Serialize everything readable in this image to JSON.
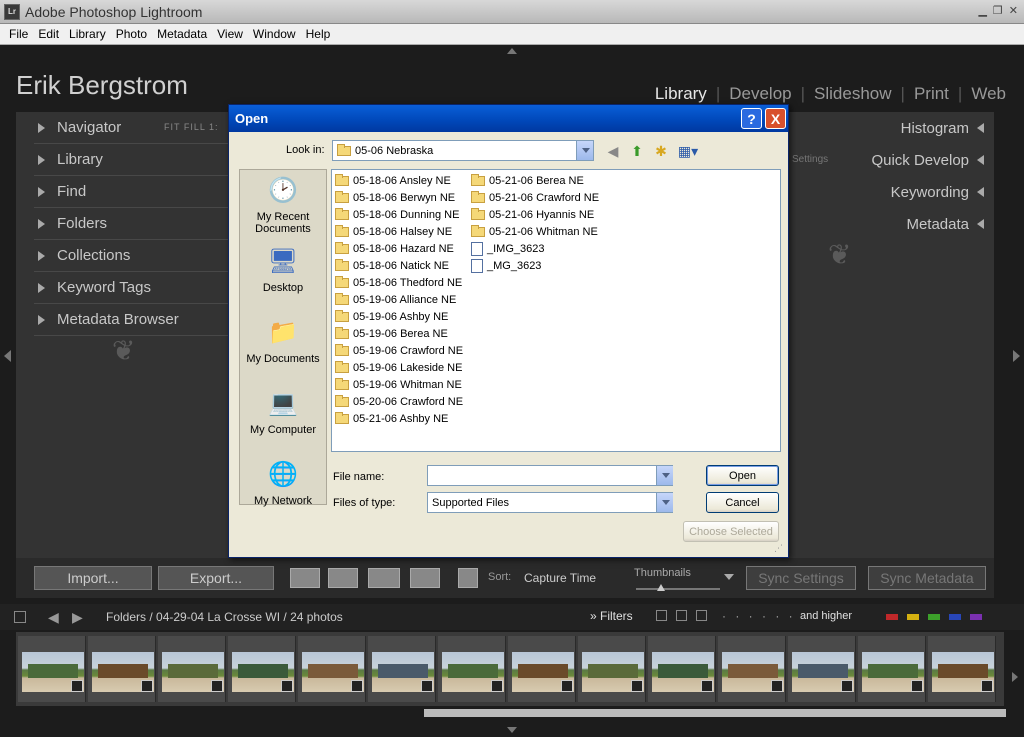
{
  "window": {
    "app_icon": "Lr",
    "title": "Adobe Photoshop Lightroom"
  },
  "menu": [
    "File",
    "Edit",
    "Library",
    "Photo",
    "Metadata",
    "View",
    "Window",
    "Help"
  ],
  "identity_plate": "Erik Bergstrom",
  "modules": [
    "Library",
    "Develop",
    "Slideshow",
    "Print",
    "Web"
  ],
  "active_module": "Library",
  "left_panels": [
    "Navigator",
    "Library",
    "Find",
    "Folders",
    "Collections",
    "Keyword Tags",
    "Metadata Browser"
  ],
  "navigator_modes": "FIT  FILL  1:",
  "right_panels": [
    "Histogram",
    "Quick Develop",
    "Keywording",
    "Metadata"
  ],
  "quick_develop_hint": "Settings",
  "toolbar": {
    "import_label": "Import...",
    "export_label": "Export...",
    "sort_label": "Sort:",
    "sort_value": "Capture Time",
    "thumbnails_label": "Thumbnails",
    "thumbnail_size": 0.3,
    "sync_settings_label": "Sync Settings",
    "sync_metadata_label": "Sync Metadata"
  },
  "filmstrip": {
    "path": "Folders / 04-29-04 La Crosse WI / 24 photos",
    "filters_label": "Filters",
    "rating_filter": "and higher",
    "color_labels": [
      "#c0282a",
      "#d4b010",
      "#3ca02a",
      "#2846b8",
      "#7a30b0"
    ],
    "thumbnail_count": 14
  },
  "dialog": {
    "title": "Open",
    "help_label": "?",
    "close_label": "X",
    "look_in_label": "Look in:",
    "look_in_value": "05-06 Nebraska",
    "places": [
      "My Recent Documents",
      "Desktop",
      "My Documents",
      "My Computer",
      "My Network"
    ],
    "folders_col1": [
      "05-18-06 Ansley NE",
      "05-18-06 Berwyn NE",
      "05-18-06 Dunning NE",
      "05-18-06 Halsey NE",
      "05-18-06 Hazard NE",
      "05-18-06 Natick NE",
      "05-18-06 Thedford NE",
      "05-19-06 Alliance NE",
      "05-19-06 Ashby NE",
      "05-19-06 Berea NE",
      "05-19-06 Crawford NE",
      "05-19-06 Lakeside NE",
      "05-19-06 Whitman NE",
      "05-20-06 Crawford NE",
      "05-21-06 Ashby NE"
    ],
    "folders_col2": [
      "05-21-06 Berea NE",
      "05-21-06 Crawford NE",
      "05-21-06 Hyannis NE",
      "05-21-06 Whitman NE"
    ],
    "files": [
      "_IMG_3623",
      "_MG_3623"
    ],
    "file_name_label": "File name:",
    "file_name_value": "",
    "file_type_label": "Files of type:",
    "file_type_value": "Supported Files",
    "open_label": "Open",
    "cancel_label": "Cancel",
    "choose_selected_label": "Choose Selected"
  }
}
